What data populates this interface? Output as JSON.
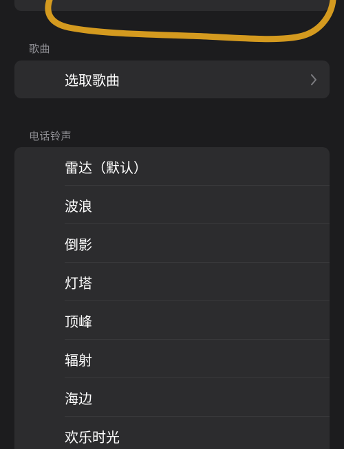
{
  "colors": {
    "background": "#1c1c1e",
    "card": "#2c2c2e",
    "separator": "#3a3a3c",
    "header_text": "#8e8e93",
    "annotation_stroke": "#d49a1f"
  },
  "songs_section": {
    "header": "歌曲",
    "pick_song_label": "选取歌曲"
  },
  "ringtones_section": {
    "header": "电话铃声",
    "items": [
      {
        "label": "雷达（默认）"
      },
      {
        "label": "波浪"
      },
      {
        "label": "倒影"
      },
      {
        "label": "灯塔"
      },
      {
        "label": "顶峰"
      },
      {
        "label": "辐射"
      },
      {
        "label": "海边"
      },
      {
        "label": "欢乐时光"
      }
    ]
  }
}
